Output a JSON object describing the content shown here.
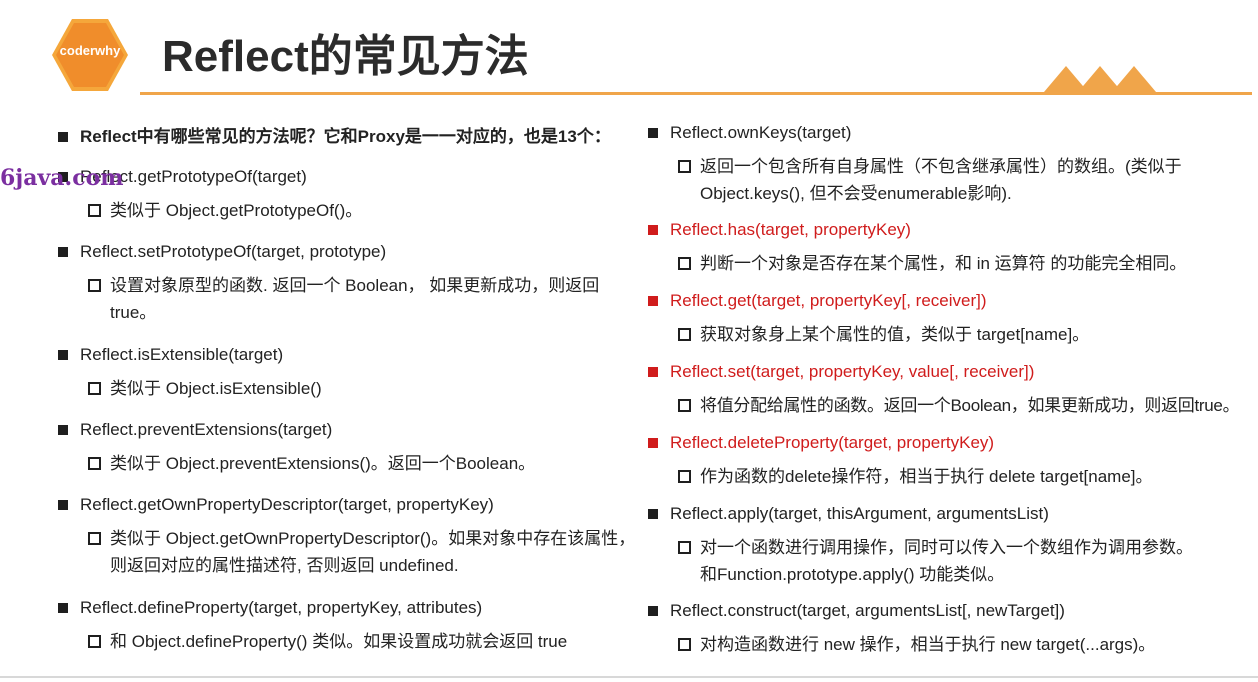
{
  "header": {
    "logo_text": "coderwhy",
    "title": "Reflect的常见方法"
  },
  "watermark": "6java.com",
  "left": {
    "intro": "Reflect中有哪些常见的方法呢？它和Proxy是一一对应的，也是13个：",
    "items": [
      {
        "method": "Reflect.getPrototypeOf(target)",
        "desc": "类似于 Object.getPrototypeOf()。"
      },
      {
        "method": "Reflect.setPrototypeOf(target, prototype)",
        "desc": "设置对象原型的函数. 返回一个 Boolean， 如果更新成功，则返回true。"
      },
      {
        "method": "Reflect.isExtensible(target)",
        "desc": "类似于 Object.isExtensible()"
      },
      {
        "method": "Reflect.preventExtensions(target)",
        "desc": "类似于 Object.preventExtensions()。返回一个Boolean。"
      },
      {
        "method": "Reflect.getOwnPropertyDescriptor(target, propertyKey)",
        "desc": "类似于 Object.getOwnPropertyDescriptor()。如果对象中存在该属性，则返回对应的属性描述符, 否则返回 undefined."
      },
      {
        "method": "Reflect.defineProperty(target, propertyKey, attributes)",
        "desc": "和 Object.defineProperty() 类似。如果设置成功就会返回 true"
      }
    ]
  },
  "right": {
    "items": [
      {
        "method": "Reflect.ownKeys(target)",
        "desc": "返回一个包含所有自身属性（不包含继承属性）的数组。(类似于Object.keys(), 但不会受enumerable影响)."
      },
      {
        "method": "Reflect.has(target, propertyKey)",
        "desc": "判断一个对象是否存在某个属性，和 in 运算符 的功能完全相同。"
      },
      {
        "method": "Reflect.get(target, propertyKey[, receiver])",
        "desc": "获取对象身上某个属性的值，类似于 target[name]。"
      },
      {
        "method": "Reflect.set(target, propertyKey, value[, receiver])",
        "desc": "将值分配给属性的函数。返回一个Boolean，如果更新成功，则返回true。"
      },
      {
        "method": "Reflect.deleteProperty(target, propertyKey)",
        "desc": "作为函数的delete操作符，相当于执行 delete target[name]。"
      },
      {
        "method": "Reflect.apply(target, thisArgument, argumentsList)",
        "desc": "对一个函数进行调用操作，同时可以传入一个数组作为调用参数。和Function.prototype.apply() 功能类似。"
      },
      {
        "method": "Reflect.construct(target, argumentsList[, newTarget])",
        "desc": "对构造函数进行 new 操作，相当于执行 new target(...args)。"
      }
    ]
  },
  "colors": {
    "accent_orange": "#f0a54a",
    "highlight_red": "#d01c1c"
  }
}
